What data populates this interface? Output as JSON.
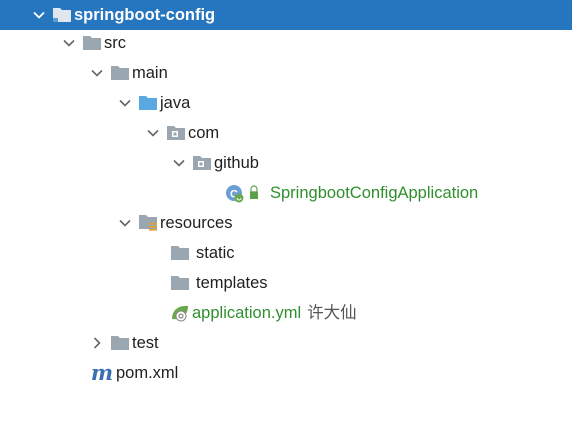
{
  "tree": {
    "root": {
      "label": "springboot-config",
      "expanded": true,
      "selected": true,
      "icon": "module-folder-icon"
    },
    "src": {
      "label": "src",
      "expanded": true,
      "icon": "folder-icon"
    },
    "main": {
      "label": "main",
      "expanded": true,
      "icon": "folder-icon"
    },
    "java": {
      "label": "java",
      "expanded": true,
      "icon": "source-root-folder-icon"
    },
    "com": {
      "label": "com",
      "expanded": true,
      "icon": "package-icon"
    },
    "github": {
      "label": "github",
      "expanded": true,
      "icon": "package-icon"
    },
    "app_class": {
      "label": "SpringbootConfigApplication",
      "icon": "spring-boot-class-icon",
      "color": "#2f8f2f"
    },
    "resources": {
      "label": "resources",
      "expanded": true,
      "icon": "resources-folder-icon"
    },
    "static": {
      "label": "static",
      "icon": "folder-icon"
    },
    "templates": {
      "label": "templates",
      "icon": "folder-icon"
    },
    "app_yml": {
      "label": "application.yml",
      "annotation": "许大仙",
      "icon": "spring-config-icon",
      "color": "#2f8f2f"
    },
    "test": {
      "label": "test",
      "expanded": false,
      "icon": "folder-icon"
    },
    "pom": {
      "label": "pom.xml",
      "icon": "maven-icon",
      "icon_text": "m"
    }
  },
  "colors": {
    "selection": "#2675bf",
    "folder": "#9aa7b0",
    "source_root": "#59a8e0",
    "green_text": "#2f8f2f"
  }
}
